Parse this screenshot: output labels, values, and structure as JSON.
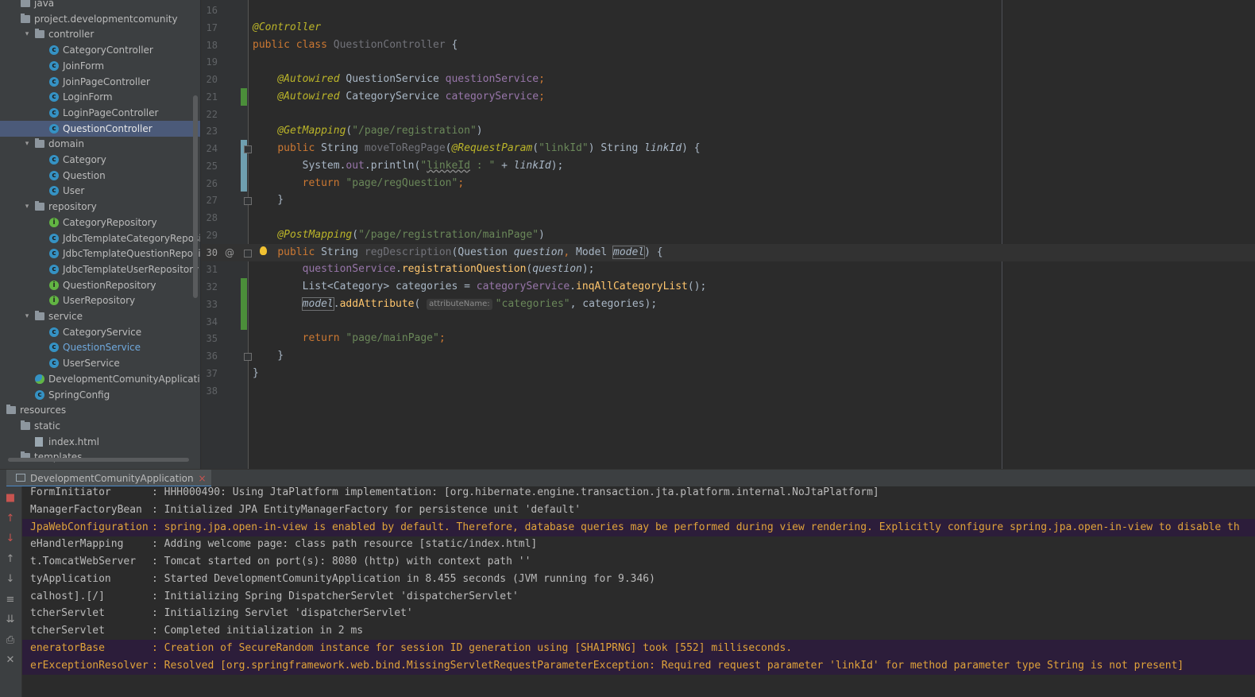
{
  "project_tree": {
    "items": [
      {
        "label": "java",
        "icon": "folder-icon",
        "indent": 0,
        "arrow": "",
        "selected": false
      },
      {
        "label": "project.developmentcomunity",
        "icon": "package-icon",
        "indent": 0,
        "arrow": "",
        "selected": false
      },
      {
        "label": "controller",
        "icon": "package-icon",
        "indent": 1,
        "arrow": "expanded",
        "selected": false
      },
      {
        "label": "CategoryController",
        "icon": "class-icon",
        "indent": 2,
        "arrow": "",
        "selected": false
      },
      {
        "label": "JoinForm",
        "icon": "class-icon",
        "indent": 2,
        "arrow": "",
        "selected": false
      },
      {
        "label": "JoinPageController",
        "icon": "class-icon",
        "indent": 2,
        "arrow": "",
        "selected": false
      },
      {
        "label": "LoginForm",
        "icon": "class-icon",
        "indent": 2,
        "arrow": "",
        "selected": false
      },
      {
        "label": "LoginPageController",
        "icon": "class-icon",
        "indent": 2,
        "arrow": "",
        "selected": false
      },
      {
        "label": "QuestionController",
        "icon": "class-icon",
        "indent": 2,
        "arrow": "",
        "selected": true
      },
      {
        "label": "domain",
        "icon": "package-icon",
        "indent": 1,
        "arrow": "expanded",
        "selected": false
      },
      {
        "label": "Category",
        "icon": "class-icon",
        "indent": 2,
        "arrow": "",
        "selected": false
      },
      {
        "label": "Question",
        "icon": "class-icon",
        "indent": 2,
        "arrow": "",
        "selected": false
      },
      {
        "label": "User",
        "icon": "class-icon",
        "indent": 2,
        "arrow": "",
        "selected": false
      },
      {
        "label": "repository",
        "icon": "package-icon",
        "indent": 1,
        "arrow": "expanded",
        "selected": false
      },
      {
        "label": "CategoryRepository",
        "icon": "interface-icon",
        "indent": 2,
        "arrow": "",
        "selected": false
      },
      {
        "label": "JdbcTemplateCategoryRepository",
        "icon": "class-icon",
        "indent": 2,
        "arrow": "",
        "selected": false
      },
      {
        "label": "JdbcTemplateQuestionRepository",
        "icon": "class-icon",
        "indent": 2,
        "arrow": "",
        "selected": false
      },
      {
        "label": "JdbcTemplateUserRepository",
        "icon": "class-icon",
        "indent": 2,
        "arrow": "",
        "selected": false
      },
      {
        "label": "QuestionRepository",
        "icon": "interface-icon",
        "indent": 2,
        "arrow": "",
        "selected": false
      },
      {
        "label": "UserRepository",
        "icon": "interface-icon",
        "indent": 2,
        "arrow": "",
        "selected": false
      },
      {
        "label": "service",
        "icon": "package-icon",
        "indent": 1,
        "arrow": "expanded",
        "selected": false
      },
      {
        "label": "CategoryService",
        "icon": "class-icon",
        "indent": 2,
        "arrow": "",
        "selected": false
      },
      {
        "label": "QuestionService",
        "icon": "class-icon",
        "indent": 2,
        "arrow": "",
        "selected": false,
        "highlight": true
      },
      {
        "label": "UserService",
        "icon": "class-icon",
        "indent": 2,
        "arrow": "",
        "selected": false
      },
      {
        "label": "DevelopmentComunityApplication",
        "icon": "springboot-app-icon",
        "indent": 1,
        "arrow": "",
        "selected": false
      },
      {
        "label": "SpringConfig",
        "icon": "class-icon",
        "indent": 1,
        "arrow": "",
        "selected": false
      },
      {
        "label": "resources",
        "icon": "folder-icon",
        "indent": -1,
        "arrow": "",
        "selected": false
      },
      {
        "label": "static",
        "icon": "folder-icon",
        "indent": 0,
        "arrow": "",
        "selected": false
      },
      {
        "label": "index.html",
        "icon": "html-file-icon",
        "indent": 1,
        "arrow": "",
        "selected": false
      },
      {
        "label": "templates",
        "icon": "folder-icon",
        "indent": 0,
        "arrow": "",
        "selected": false
      }
    ]
  },
  "editor": {
    "first_line": 16,
    "current_line": 30,
    "lines": [
      [],
      [
        {
          "t": "@Controller",
          "c": "ann"
        }
      ],
      [
        {
          "t": "public class ",
          "c": "kw"
        },
        {
          "t": "QuestionController",
          "c": "unused"
        },
        {
          "t": " {",
          "c": "type"
        }
      ],
      [],
      [
        {
          "t": "    "
        },
        {
          "t": "@Autowired",
          "c": "ann"
        },
        {
          "t": " QuestionService ",
          "c": "type"
        },
        {
          "t": "questionService",
          "c": "fld"
        },
        {
          "t": ";",
          "c": "kw"
        }
      ],
      [
        {
          "t": "    "
        },
        {
          "t": "@Autowired",
          "c": "ann"
        },
        {
          "t": " CategoryService ",
          "c": "type"
        },
        {
          "t": "categoryService",
          "c": "fld"
        },
        {
          "t": ";",
          "c": "kw"
        }
      ],
      [],
      [
        {
          "t": "    "
        },
        {
          "t": "@GetMapping",
          "c": "ann"
        },
        {
          "t": "(",
          "c": "type"
        },
        {
          "t": "\"/page/registration\"",
          "c": "str"
        },
        {
          "t": ")",
          "c": "type"
        }
      ],
      [
        {
          "t": "    "
        },
        {
          "t": "public ",
          "c": "kw"
        },
        {
          "t": "String ",
          "c": "type"
        },
        {
          "t": "moveToRegPage",
          "c": "unused"
        },
        {
          "t": "(",
          "c": "type"
        },
        {
          "t": "@RequestParam",
          "c": "ann"
        },
        {
          "t": "(",
          "c": "type"
        },
        {
          "t": "\"linkId\"",
          "c": "str"
        },
        {
          "t": ") String ",
          "c": "type"
        },
        {
          "t": "linkId",
          "c": "param"
        },
        {
          "t": ") {",
          "c": "type"
        }
      ],
      [
        {
          "t": "        System.",
          "c": "type"
        },
        {
          "t": "out",
          "c": "fld"
        },
        {
          "t": ".println(",
          "c": "type"
        },
        {
          "t": "\"",
          "c": "str"
        },
        {
          "t": "linkeId",
          "c": "str squig"
        },
        {
          "t": " : \"",
          "c": "str"
        },
        {
          "t": " + ",
          "c": "type"
        },
        {
          "t": "linkId",
          "c": "param"
        },
        {
          "t": ");",
          "c": "type"
        }
      ],
      [
        {
          "t": "        "
        },
        {
          "t": "return ",
          "c": "kw"
        },
        {
          "t": "\"page/regQuestion\"",
          "c": "str"
        },
        {
          "t": ";",
          "c": "kw"
        }
      ],
      [
        {
          "t": "    }",
          "c": "type"
        }
      ],
      [],
      [
        {
          "t": "    "
        },
        {
          "t": "@PostMapping",
          "c": "ann"
        },
        {
          "t": "(",
          "c": "type"
        },
        {
          "t": "\"/page/registration/mainPage\"",
          "c": "str"
        },
        {
          "t": ")",
          "c": "type"
        }
      ],
      [
        {
          "t": "    "
        },
        {
          "t": "public ",
          "c": "kw"
        },
        {
          "t": "String ",
          "c": "type"
        },
        {
          "t": "regDescription",
          "c": "unused"
        },
        {
          "t": "(",
          "c": "type"
        },
        {
          "t": "Question ",
          "c": "type"
        },
        {
          "t": "question",
          "c": "param"
        },
        {
          "t": ", ",
          "c": "kw"
        },
        {
          "t": "Model ",
          "c": "type"
        },
        {
          "t": "model",
          "c": "param boxed"
        },
        {
          "t": ") {",
          "c": "type"
        }
      ],
      [
        {
          "t": "        "
        },
        {
          "t": "questionService",
          "c": "fld"
        },
        {
          "t": ".",
          "c": "type"
        },
        {
          "t": "registrationQuestion",
          "c": "mth"
        },
        {
          "t": "(",
          "c": "type"
        },
        {
          "t": "question",
          "c": "param"
        },
        {
          "t": ");",
          "c": "type"
        }
      ],
      [
        {
          "t": "        List<Category> categories = ",
          "c": "type"
        },
        {
          "t": "categoryService",
          "c": "fld"
        },
        {
          "t": ".",
          "c": "type"
        },
        {
          "t": "inqAllCategoryList",
          "c": "mth"
        },
        {
          "t": "();",
          "c": "type"
        }
      ],
      [
        {
          "t": "        "
        },
        {
          "t": "model",
          "c": "param boxed"
        },
        {
          "t": ".",
          "c": "type"
        },
        {
          "t": "addAttribute",
          "c": "mth"
        },
        {
          "t": "( ",
          "c": "type"
        },
        {
          "hint": "attributeName:"
        },
        {
          "t": "\"categories\"",
          "c": "str"
        },
        {
          "t": ", categories);",
          "c": "type"
        }
      ],
      [],
      [
        {
          "t": "        "
        },
        {
          "t": "return ",
          "c": "kw"
        },
        {
          "t": "\"page/mainPage\"",
          "c": "str"
        },
        {
          "t": ";",
          "c": "kw"
        }
      ],
      [
        {
          "t": "    }",
          "c": "type"
        }
      ],
      [
        {
          "t": "}",
          "c": "type"
        }
      ],
      []
    ],
    "change_markers": [
      {
        "line": 21,
        "kind": "added",
        "span": 1
      },
      {
        "line": 24,
        "kind": "modified",
        "span": 3
      },
      {
        "line": 32,
        "kind": "added",
        "span": 3
      }
    ],
    "fold_markers": [
      24,
      27,
      30,
      36
    ],
    "at_marker_line": 30,
    "bulb_line": 30
  },
  "run_panel": {
    "tab_label": "DevelopmentComunityApplication",
    "toolbar": [
      {
        "name": "stop-icon",
        "glyph": "■",
        "red": true
      },
      {
        "name": "rerun-up-icon",
        "glyph": "↑",
        "red": true
      },
      {
        "name": "rerun-down-icon",
        "glyph": "↓",
        "red": true
      },
      {
        "name": "scroll-up-icon",
        "glyph": "↑",
        "red": false
      },
      {
        "name": "scroll-down-icon",
        "glyph": "↓",
        "red": false
      },
      {
        "name": "soft-wrap-icon",
        "glyph": "≡",
        "red": false
      },
      {
        "name": "scroll-to-end-icon",
        "glyph": "⇊",
        "red": false
      },
      {
        "name": "print-icon",
        "glyph": "⎙",
        "red": false
      },
      {
        "name": "clear-all-icon",
        "glyph": "✕",
        "red": false
      }
    ],
    "lines": [
      {
        "src": "FormInitiator",
        "msg": ": HHH000490: Using JtaPlatform implementation: [org.hibernate.engine.transaction.jta.platform.internal.NoJtaPlatform]",
        "level": "info"
      },
      {
        "src": "ManagerFactoryBean",
        "msg": ": Initialized JPA EntityManagerFactory for persistence unit 'default'",
        "level": "info"
      },
      {
        "src": "JpaWebConfiguration",
        "msg": ": spring.jpa.open-in-view is enabled by default. Therefore, database queries may be performed during view rendering. Explicitly configure spring.jpa.open-in-view to disable th",
        "level": "warn"
      },
      {
        "src": "eHandlerMapping",
        "msg": ": Adding welcome page: class path resource [static/index.html]",
        "level": "info"
      },
      {
        "src": "t.TomcatWebServer",
        "msg": ": Tomcat started on port(s): 8080 (http) with context path ''",
        "level": "info"
      },
      {
        "src": "tyApplication",
        "msg": ": Started DevelopmentComunityApplication in 8.455 seconds (JVM running for 9.346)",
        "level": "info"
      },
      {
        "src": "calhost].[/]",
        "msg": ": Initializing Spring DispatcherServlet 'dispatcherServlet'",
        "level": "info"
      },
      {
        "src": "tcherServlet",
        "msg": ": Initializing Servlet 'dispatcherServlet'",
        "level": "info"
      },
      {
        "src": "tcherServlet",
        "msg": ": Completed initialization in 2 ms",
        "level": "info"
      },
      {
        "src": "eneratorBase",
        "msg": ": Creation of SecureRandom instance for session ID generation using [SHA1PRNG] took [552] milliseconds.",
        "level": "warn"
      },
      {
        "src": "erExceptionResolver",
        "msg": ": Resolved [org.springframework.web.bind.MissingServletRequestParameterException: Required request parameter 'linkId' for method parameter type String is not present]",
        "level": "warn"
      }
    ]
  }
}
